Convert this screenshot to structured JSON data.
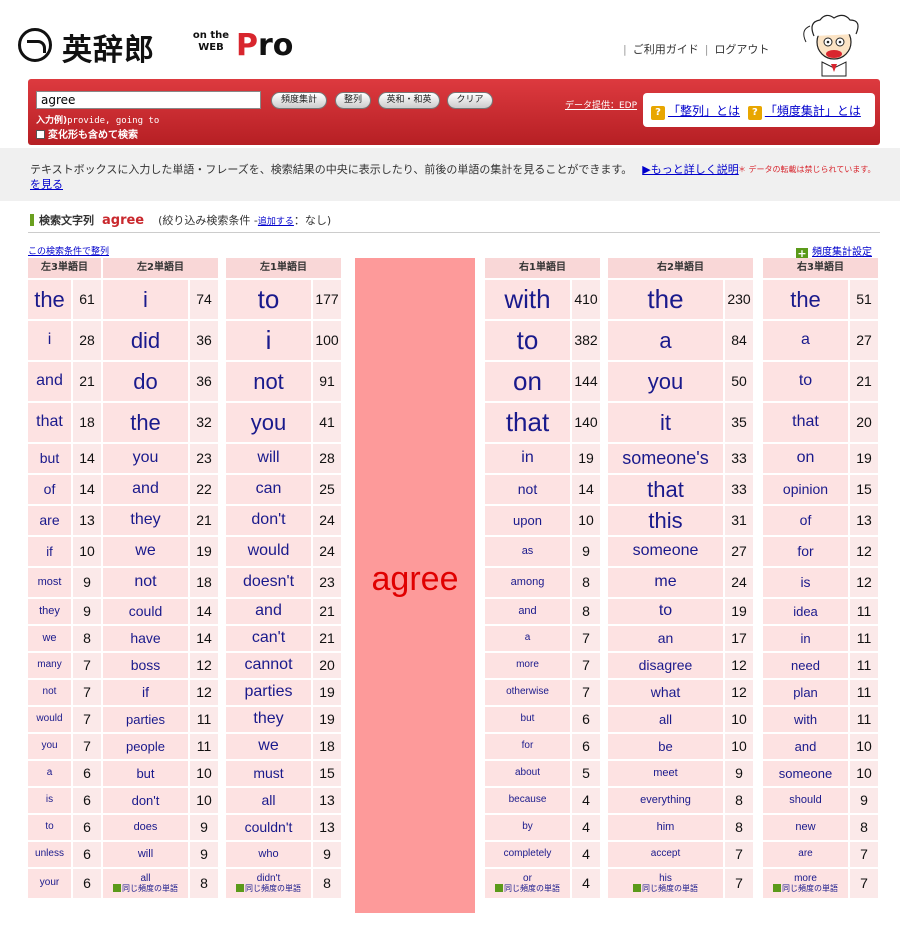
{
  "header": {
    "logo_text": "英辞郎",
    "logo_on_the": "on the",
    "logo_web": "WEB",
    "logo_pro_p": "P",
    "logo_pro_rest": "ro",
    "links": [
      "ご利用ガイド",
      "ログアウト"
    ]
  },
  "search": {
    "value": "agree",
    "buttons": [
      "頻度集計",
      "整列",
      "英和・和英",
      "クリア"
    ],
    "example_label": "入力例)",
    "example_text": "provide, going to",
    "variant_label": "変化形も含めて検索",
    "data_credit": "データ提供：EDP",
    "help_sort": "「整列」とは",
    "help_freq": "「頻度集計」とは"
  },
  "info": {
    "text": "テキストボックスに入力した単語・フレーズを、検索結果の中央に表示したり、前後の単語の集計を見ることができます。",
    "more_link": "▶もっと詳しく説明を見る",
    "note": "＊ データの転載は禁じられています。"
  },
  "query": {
    "label": "検索文字列",
    "word": "agree",
    "filter_prefix": "(絞り込み検索条件 -",
    "filter_link": "追加する",
    "filter_suffix": "：なし)",
    "sort_link": "この検索条件で整列",
    "freq_settings": "頻度集計設定"
  },
  "colors": {
    "red": "#c9282d",
    "center": "#fd9a9a",
    "cell": "#fde2e2",
    "word": "#1a1a8c"
  },
  "more_label": "同じ頻度の単語",
  "center_word": "agree",
  "columns": [
    {
      "header": "左3単語目",
      "words": [
        "the",
        "i",
        "and",
        "that",
        "but",
        "of",
        "are",
        "if",
        "most",
        "they",
        "we",
        "many",
        "not",
        "would",
        "you",
        "a",
        "is",
        "to",
        "unless",
        "your"
      ],
      "counts": [
        61,
        28,
        21,
        18,
        14,
        14,
        13,
        10,
        9,
        9,
        8,
        7,
        7,
        7,
        7,
        6,
        6,
        6,
        6,
        6
      ],
      "more_last": false
    },
    {
      "header": "左2単語目",
      "words": [
        "i",
        "did",
        "do",
        "the",
        "you",
        "and",
        "they",
        "we",
        "not",
        "could",
        "have",
        "boss",
        "if",
        "parties",
        "people",
        "but",
        "don't",
        "does",
        "will",
        "all"
      ],
      "counts": [
        74,
        36,
        36,
        32,
        23,
        22,
        21,
        19,
        18,
        14,
        14,
        12,
        12,
        11,
        11,
        10,
        10,
        9,
        9,
        8
      ],
      "more_last": true
    },
    {
      "header": "左1単語目",
      "words": [
        "to",
        "i",
        "not",
        "you",
        "will",
        "can",
        "don't",
        "would",
        "doesn't",
        "and",
        "can't",
        "cannot",
        "parties",
        "they",
        "we",
        "must",
        "all",
        "couldn't",
        "who",
        "didn't"
      ],
      "counts": [
        177,
        100,
        91,
        41,
        28,
        25,
        24,
        24,
        23,
        21,
        21,
        20,
        19,
        19,
        18,
        15,
        13,
        13,
        9,
        8
      ],
      "more_last": true
    },
    {
      "header": "右1単語目",
      "words": [
        "with",
        "to",
        "on",
        "that",
        "in",
        "not",
        "upon",
        "as",
        "among",
        "and",
        "a",
        "more",
        "otherwise",
        "but",
        "for",
        "about",
        "because",
        "by",
        "completely",
        "or"
      ],
      "counts": [
        410,
        382,
        144,
        140,
        19,
        14,
        10,
        9,
        8,
        8,
        7,
        7,
        7,
        6,
        6,
        5,
        4,
        4,
        4,
        4
      ],
      "more_last": true
    },
    {
      "header": "右2単語目",
      "words": [
        "the",
        "a",
        "you",
        "it",
        "someone's",
        "that",
        "this",
        "someone",
        "me",
        "to",
        "an",
        "disagree",
        "what",
        "all",
        "be",
        "meet",
        "everything",
        "him",
        "accept",
        "his"
      ],
      "counts": [
        230,
        84,
        50,
        35,
        33,
        33,
        31,
        27,
        24,
        19,
        17,
        12,
        12,
        10,
        10,
        9,
        8,
        8,
        7,
        7
      ],
      "more_last": true
    },
    {
      "header": "右3単語目",
      "words": [
        "the",
        "a",
        "to",
        "that",
        "on",
        "opinion",
        "of",
        "for",
        "is",
        "idea",
        "in",
        "need",
        "plan",
        "with",
        "and",
        "someone",
        "should",
        "new",
        "are",
        "more"
      ],
      "counts": [
        51,
        27,
        21,
        20,
        19,
        15,
        13,
        12,
        12,
        11,
        11,
        11,
        11,
        11,
        10,
        10,
        9,
        8,
        7,
        7
      ],
      "more_last": true
    }
  ]
}
